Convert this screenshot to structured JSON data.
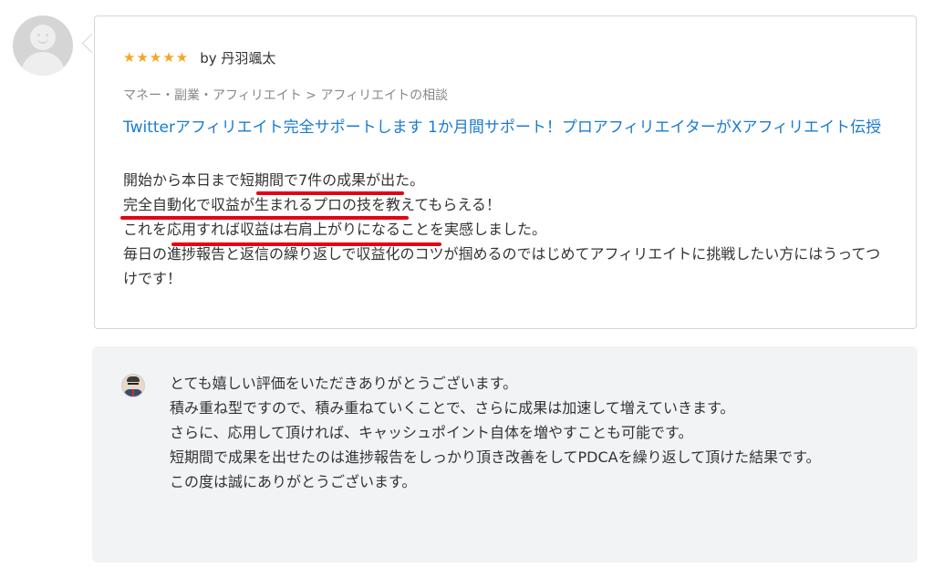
{
  "review": {
    "rating_stars": "★★★★★",
    "reviewer": "by 丹羽颯太",
    "breadcrumb": "マネー・副業・アフィリエイト > アフィリエイトの相談",
    "service_title": "Twitterアフィリエイト完全サポートします 1か月間サポート！プロアフィリエイターがXアフィリエイト伝授",
    "lines": [
      "開始から本日まで短期間で7件の成果が出た。",
      "完全自動化で収益が生まれるプロの技を教えてもらえる！",
      "これを応用すれば収益は右肩上がりになることを実感しました。",
      "毎日の進捗報告と返信の繰り返しで収益化のコツが掴めるのではじめてアフィリエイトに挑戦したい方にはうってつけです！"
    ]
  },
  "reply": {
    "lines": [
      "とても嬉しい評価をいただきありがとうございます。",
      "積み重ね型ですので、積み重ねていくことで、さらに成果は加速して増えていきます。",
      "さらに、応用して頂ければ、キャッシュポイント自体を増やすことも可能です。",
      "短期間で成果を出せたのは進捗報告をしっかり頂き改善をしてPDCAを繰り返して頂けた結果です。",
      "この度は誠にありがとうございます。"
    ]
  },
  "colors": {
    "star": "#f5a623",
    "link": "#1a7bd0",
    "underline_mark": "#e60012",
    "reply_bg": "#f2f3f5"
  }
}
